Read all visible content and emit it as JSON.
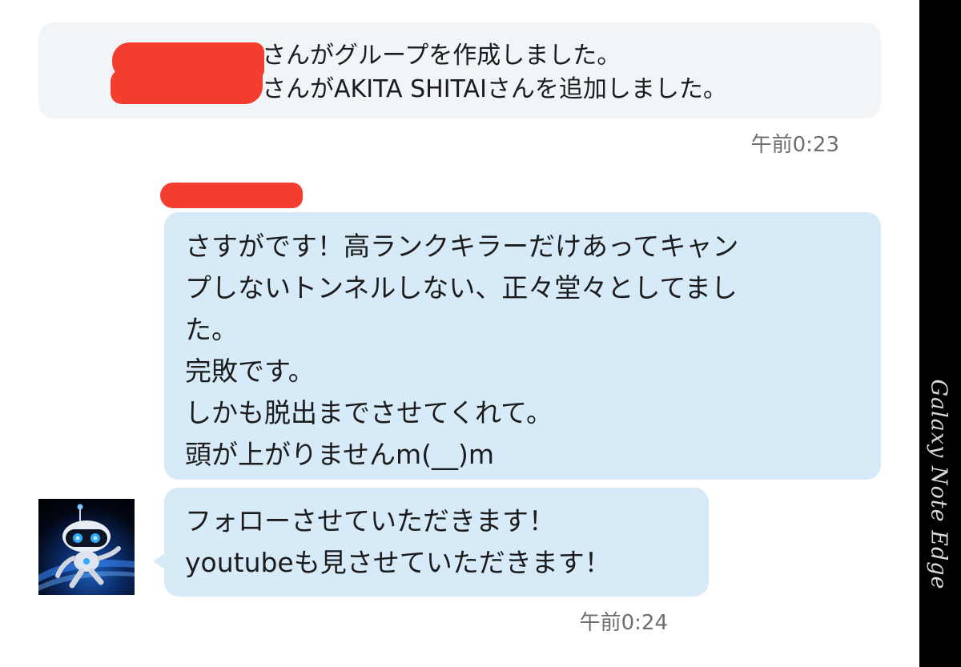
{
  "system_message": {
    "line1": "さんがグループを作成しました。",
    "line2": "さんがAKITA SHITAIさんを追加しました。",
    "timestamp": "午前0:23"
  },
  "messages": [
    {
      "lines": [
        "さすがです！高ランクキラーだけあってキャン",
        "プしないトンネルしない、正々堂々としてまし",
        "た。",
        "完敗です。",
        "しかも脱出までさせてくれて。",
        "頭が上がりませんm(__)m"
      ]
    },
    {
      "lines": [
        "フォローさせていただきます！",
        "youtubeも見させていただきます！"
      ],
      "timestamp": "午前0:24"
    }
  ],
  "watermark": "Galaxy Note Edge",
  "colors": {
    "bubble": "#d6eaf8",
    "system_box": "#f1f5f7",
    "redaction": "#f33d2e",
    "timestamp_text": "#6f6f6f",
    "edge_strip": "#000000"
  },
  "icons": {
    "avatar": "robot-avatar-icon"
  }
}
